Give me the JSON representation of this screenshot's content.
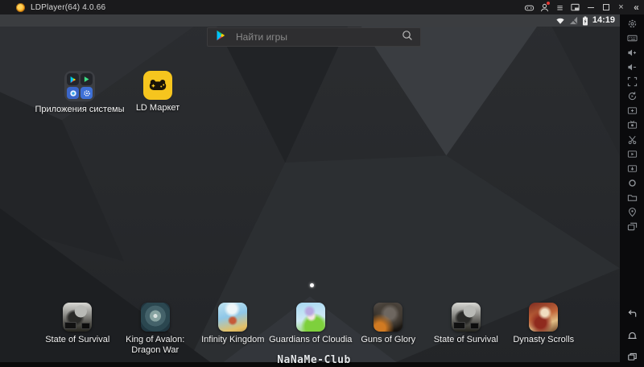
{
  "window": {
    "title": "LDPlayer(64) 4.0.66",
    "controls": [
      "gamepad",
      "account-with-notification",
      "menu",
      "mini-window",
      "minimize",
      "maximize",
      "close",
      "collapse-toolbar"
    ]
  },
  "android": {
    "status_bar": {
      "time": "14:19",
      "icons": [
        "wifi",
        "no-sim-signal",
        "battery-charging"
      ]
    },
    "search": {
      "placeholder": "Найти игры",
      "icons": [
        "google-play",
        "magnifier"
      ]
    },
    "desktop_items": [
      {
        "label": "Приложения системы",
        "type": "folder",
        "folder_apps": [
          "google-play",
          "green-play",
          "browser",
          "settings"
        ]
      },
      {
        "label": "LD Маркет",
        "type": "app",
        "icon": "ld-market-gamepad",
        "tile_color": "#f6c51e"
      }
    ],
    "page_indicator": {
      "dots": 1,
      "active_dot": 1
    },
    "dock_items": [
      {
        "label": "State of Survival"
      },
      {
        "label": "King of Avalon: Dragon War"
      },
      {
        "label": "Infinity Kingdom"
      },
      {
        "label": "Guardians of Cloudia"
      },
      {
        "label": "Guns of Glory"
      },
      {
        "label": "State of Survival"
      },
      {
        "label": "Dynasty Scrolls"
      }
    ],
    "navigation": [
      "back",
      "home",
      "recents"
    ]
  },
  "toolbar": {
    "items": [
      "settings",
      "keyboard",
      "volume-up",
      "volume-down",
      "fullscreen",
      "rotate-screen",
      "screenshot",
      "screen-record",
      "clip",
      "video-player",
      "install-apk",
      "shake",
      "shared-folder",
      "virtual-gps",
      "multi-window"
    ]
  },
  "watermark": {
    "text": "NaNaMe-Club"
  },
  "colors": {
    "accent_yellow": "#f6c51e",
    "titlebar": "#1a1a1c",
    "statusbar": "#3b3d40",
    "wallpaper_base": "#292b2e",
    "toolbar_bg": "#0a0a0c"
  }
}
